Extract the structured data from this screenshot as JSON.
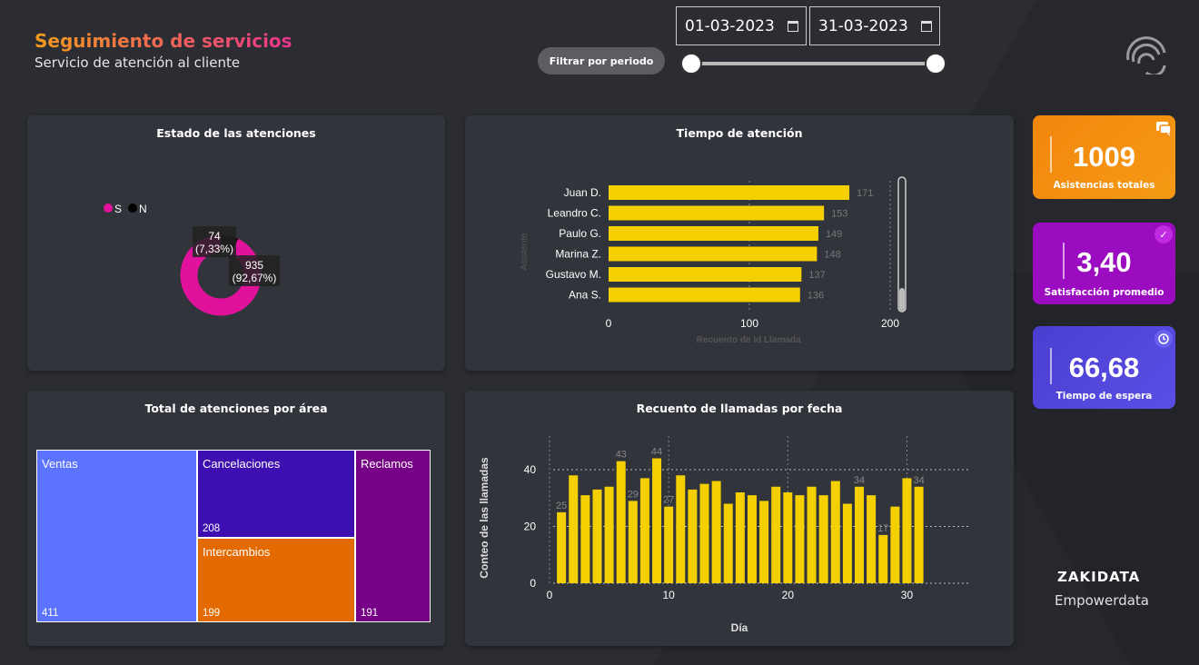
{
  "header": {
    "title": "Seguimiento de servicios",
    "subtitle": "Servicio de atención al cliente",
    "filter_label": "Filtrar por periodo",
    "date_start": "01-03-2023",
    "date_end": "31-03-2023"
  },
  "status_card": {
    "title": "Estado de las atenciones",
    "legend": [
      {
        "label": "S",
        "color": "#e0129c"
      },
      {
        "label": "N",
        "color": "#000000"
      }
    ],
    "slices": [
      {
        "label": "S",
        "count": "935",
        "pct": "(92,67%)",
        "value": 935
      },
      {
        "label": "N",
        "count": "74",
        "pct": "(7,33%)",
        "value": 74
      }
    ]
  },
  "time_card": {
    "title": "Tiempo de atención",
    "ylabel": "Asistente",
    "xlabel": "Recuento de Id Llamada"
  },
  "area_card": {
    "title": "Total de atenciones por área",
    "cells": [
      {
        "name": "Ventas",
        "value": "411",
        "color": "#5b73ff"
      },
      {
        "name": "Cancelaciones",
        "value": "208",
        "color": "#3d0fb0"
      },
      {
        "name": "Intercambios",
        "value": "199",
        "color": "#e46a00"
      },
      {
        "name": "Reclamos",
        "value": "191",
        "color": "#760086"
      }
    ]
  },
  "date_card": {
    "title": "Recuento de llamadas por fecha"
  },
  "kpis": [
    {
      "value": "1009",
      "label": "Asistencias totales",
      "icon": "chat-icon"
    },
    {
      "value": "3,40",
      "label": "Satisfacción promedio",
      "icon": "check-icon"
    },
    {
      "value": "66,68",
      "label": "Tiempo de espera",
      "icon": "clock-icon"
    }
  ],
  "brand": {
    "name": "ZAKIDATA",
    "tagline": "Empowerdata"
  },
  "chart_data": [
    {
      "type": "pie",
      "categories": [
        "S",
        "N"
      ],
      "values": [
        935,
        74
      ],
      "labels": [
        "935 (92,67%)",
        "74 (7,33%)"
      ],
      "title": "Estado de las atenciones",
      "legend": "top-left"
    },
    {
      "type": "bar",
      "orientation": "horizontal",
      "title": "Tiempo de atención",
      "categories": [
        "Juan D.",
        "Leandro C.",
        "Paulo G.",
        "Marina Z.",
        "Gustavo M.",
        "Ana S."
      ],
      "values": [
        171,
        153,
        149,
        148,
        137,
        136
      ],
      "xlabel": "Recuento de Id Llamada",
      "ylabel": "Asistente",
      "xlim": [
        0,
        200
      ],
      "xticks": [
        "0",
        "100",
        "200"
      ]
    },
    {
      "type": "bar",
      "title": "Recuento de llamadas por fecha",
      "xlabel": "Día",
      "ylabel": "Conteo de las llamadas",
      "x": [
        1,
        2,
        3,
        4,
        5,
        6,
        7,
        8,
        9,
        10,
        11,
        12,
        13,
        14,
        15,
        16,
        17,
        18,
        19,
        20,
        21,
        22,
        23,
        24,
        25,
        26,
        27,
        28,
        29,
        30,
        31
      ],
      "values": [
        25,
        38,
        31,
        33,
        34,
        43,
        29,
        37,
        44,
        27,
        38,
        33,
        35,
        36,
        28,
        32,
        31,
        29,
        34,
        32,
        31,
        34,
        31,
        36,
        28,
        34,
        31,
        17,
        27,
        37,
        34
      ],
      "data_labels": {
        "1": "25",
        "6": "43",
        "7": "29",
        "9": "44",
        "10": "27",
        "26": "34",
        "28": "17",
        "31": "34"
      },
      "ylim": [
        0,
        44
      ],
      "xticks": [
        "0",
        "10",
        "20",
        "30"
      ],
      "yticks": [
        "0",
        "20",
        "40"
      ]
    }
  ]
}
